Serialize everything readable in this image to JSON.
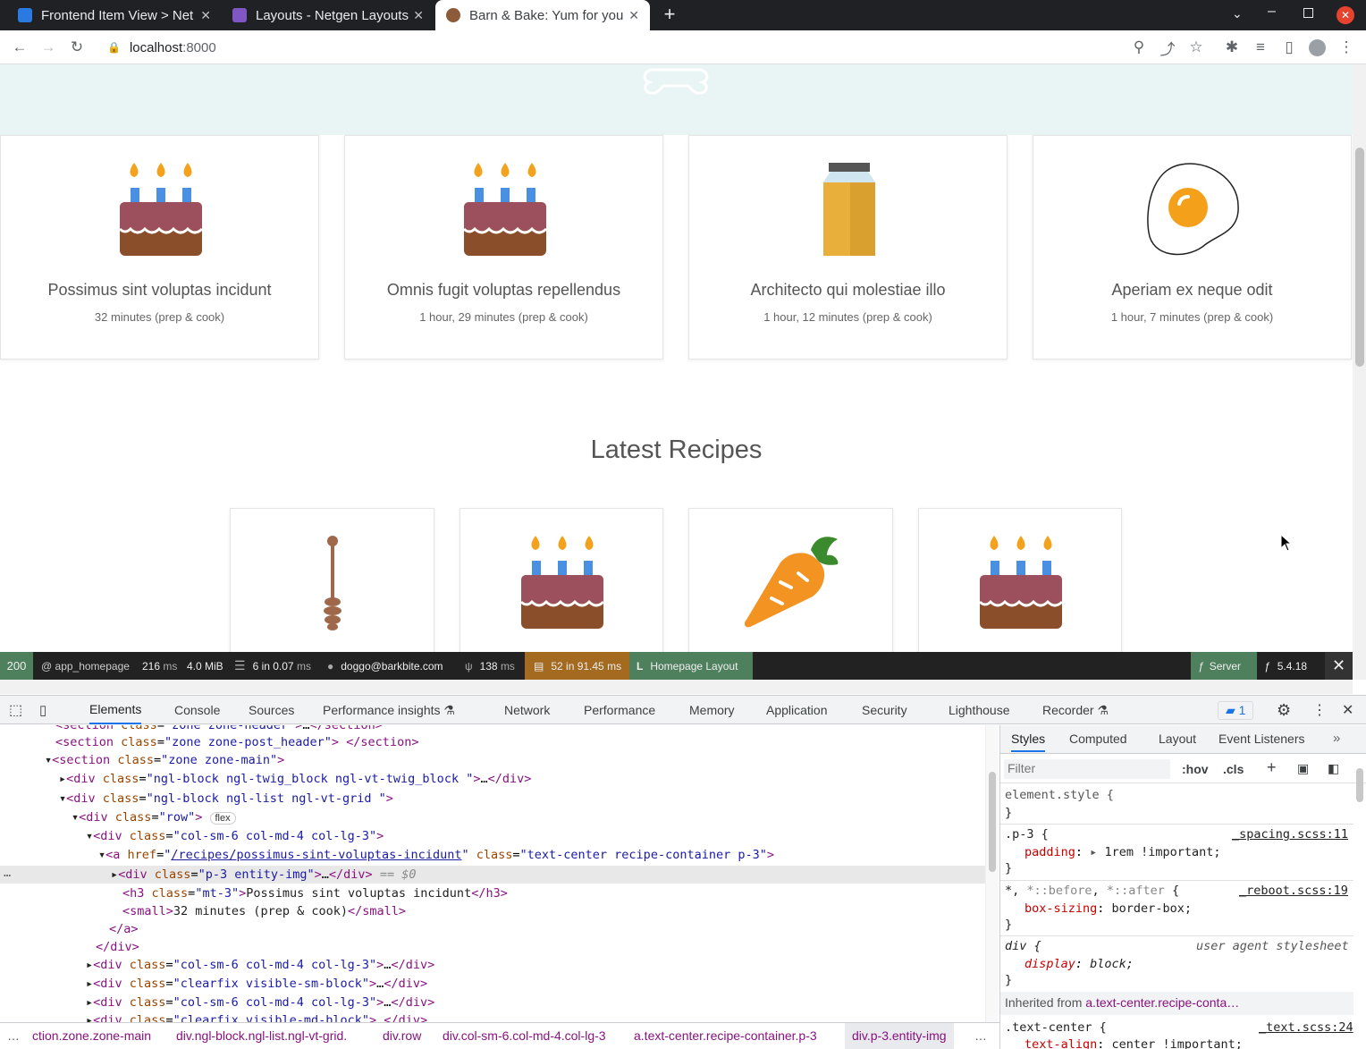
{
  "browser": {
    "tabs": [
      {
        "title": "Frontend Item View > Net",
        "color": "#2a7ae2"
      },
      {
        "title": "Layouts - Netgen Layouts",
        "color": "#7e57c2"
      },
      {
        "title": "Barn & Bake: Yum for you",
        "color": "#8d5a3a"
      }
    ],
    "url_host": "localhost",
    "url_port": ":8000"
  },
  "page": {
    "featured": [
      {
        "title": "Possimus sint voluptas incidunt",
        "time": "32 minutes (prep & cook)",
        "icon": "cake-icon"
      },
      {
        "title": "Omnis fugit voluptas repellendus",
        "time": "1 hour, 29 minutes (prep & cook)",
        "icon": "cake-icon"
      },
      {
        "title": "Architecto qui molestiae illo",
        "time": "1 hour, 12 minutes (prep & cook)",
        "icon": "honey-jar-icon"
      },
      {
        "title": "Aperiam ex neque odit",
        "time": "1 hour, 7 minutes (prep & cook)",
        "icon": "egg-icon"
      }
    ],
    "latest_heading": "Latest Recipes",
    "latest_icons": [
      "honey-dipper-icon",
      "cake-icon",
      "carrot-icon",
      "cake-icon"
    ]
  },
  "sf_toolbar": {
    "status": "200",
    "route": "@ app_homepage",
    "time": "216",
    "time_unit": "ms",
    "memory": "4.0 MiB",
    "cache": "6 in 0.07",
    "cache_unit": "ms",
    "user": "doggo@barkbite.com",
    "twig": "138",
    "twig_unit": "ms",
    "db": "52 in 91.45",
    "db_unit": "ms",
    "layout": "Homepage Layout",
    "server": "Server",
    "version": "5.4.18"
  },
  "devtools": {
    "tabs": [
      "Elements",
      "Console",
      "Sources",
      "Performance insights",
      "Network",
      "Performance",
      "Memory",
      "Application",
      "Security",
      "Lighthouse",
      "Recorder"
    ],
    "issues_count": "1",
    "side_tabs": [
      "Styles",
      "Computed",
      "Layout",
      "Event Listeners"
    ],
    "filter_placeholder": "Filter",
    "hov": ":hov",
    "cls": ".cls",
    "breadcrumbs": [
      "ction.zone.zone-main",
      "div.ngl-block.ngl-list.ngl-vt-grid.",
      "div.row",
      "div.col-sm-6.col-md-4.col-lg-3",
      "a.text-center.recipe-container.p-3",
      "div.p-3.entity-img"
    ],
    "inherited_label": "Inherited from",
    "inherited_from": "a.text-center.recipe-conta…"
  }
}
